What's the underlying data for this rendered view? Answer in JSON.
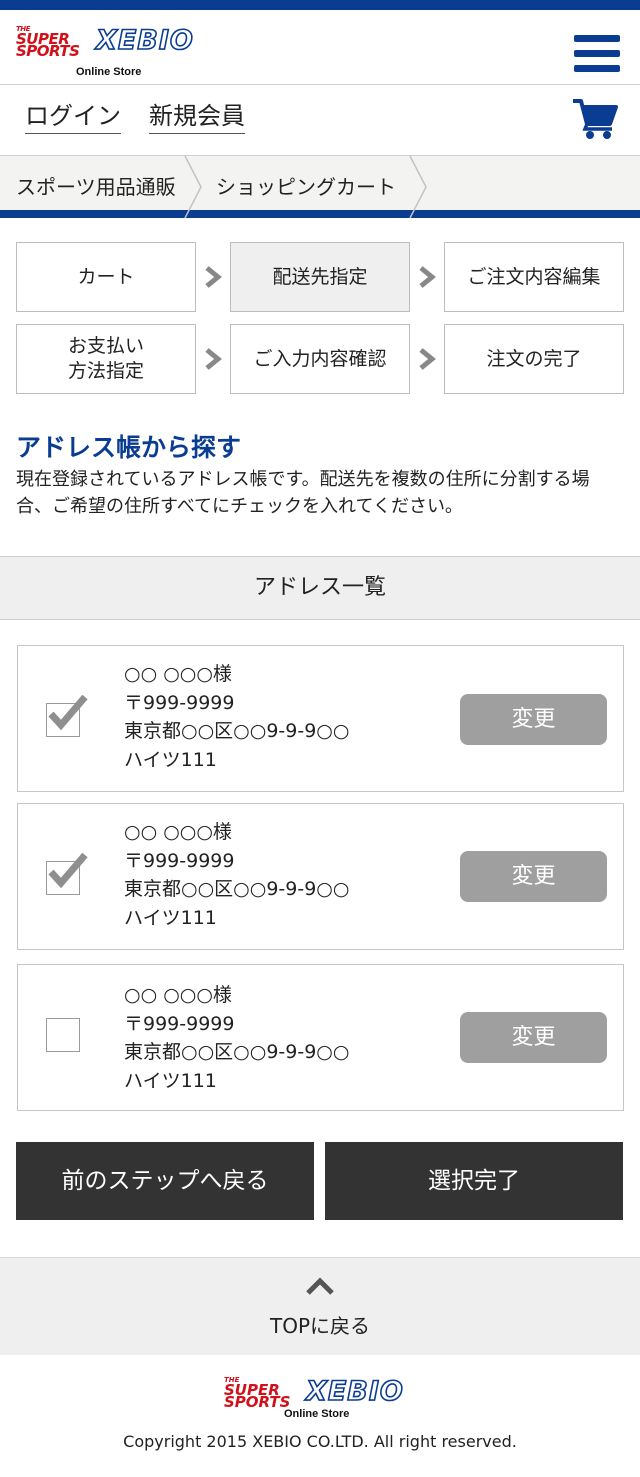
{
  "brand": {
    "logo_the": "THE",
    "logo_super": "SUPER",
    "logo_sports": "SPORTS",
    "logo_xebio": "XEBIO",
    "logo_sub": "Online Store",
    "primary_color": "#0a3d91",
    "accent_color": "#d2101a"
  },
  "header": {
    "menu_icon": "hamburger-menu-icon"
  },
  "auth": {
    "login": "ログイン",
    "register": "新規会員",
    "cart_icon": "shopping-cart-icon"
  },
  "breadcrumb": [
    "スポーツ用品通販",
    "ショッピングカート"
  ],
  "steps": [
    {
      "label": "カート",
      "active": false
    },
    {
      "label": "配送先指定",
      "active": true
    },
    {
      "label": "ご注文内容編集",
      "active": false
    },
    {
      "label": "お支払い\n方法指定",
      "active": false
    },
    {
      "label": "ご入力内容確認",
      "active": false
    },
    {
      "label": "注文の完了",
      "active": false
    }
  ],
  "section": {
    "title": "アドレス帳から探す",
    "description": "現在登録されているアドレス帳です。配送先を複数の住所に分割する場合、ご希望の住所すべてにチェックを入れてください。"
  },
  "address_list": {
    "heading": "アドレス一覧",
    "change_label": "変更",
    "items": [
      {
        "name": "○○ ○○○様",
        "postal": "〒999-9999",
        "address1": "東京都○○区○○9-9-9○○",
        "address2": "ハイツ111",
        "checked": true
      },
      {
        "name": "○○ ○○○様",
        "postal": "〒999-9999",
        "address1": "東京都○○区○○9-9-9○○",
        "address2": "ハイツ111",
        "checked": true
      },
      {
        "name": "○○ ○○○様",
        "postal": "〒999-9999",
        "address1": "東京都○○区○○9-9-9○○",
        "address2": "ハイツ111",
        "checked": false
      }
    ]
  },
  "actions": {
    "back": "前のステップへ戻る",
    "complete": "選択完了"
  },
  "footer": {
    "to_top": "TOPに戻る",
    "copyright": "Copyright 2015 XEBIO CO.LTD. All right reserved."
  }
}
